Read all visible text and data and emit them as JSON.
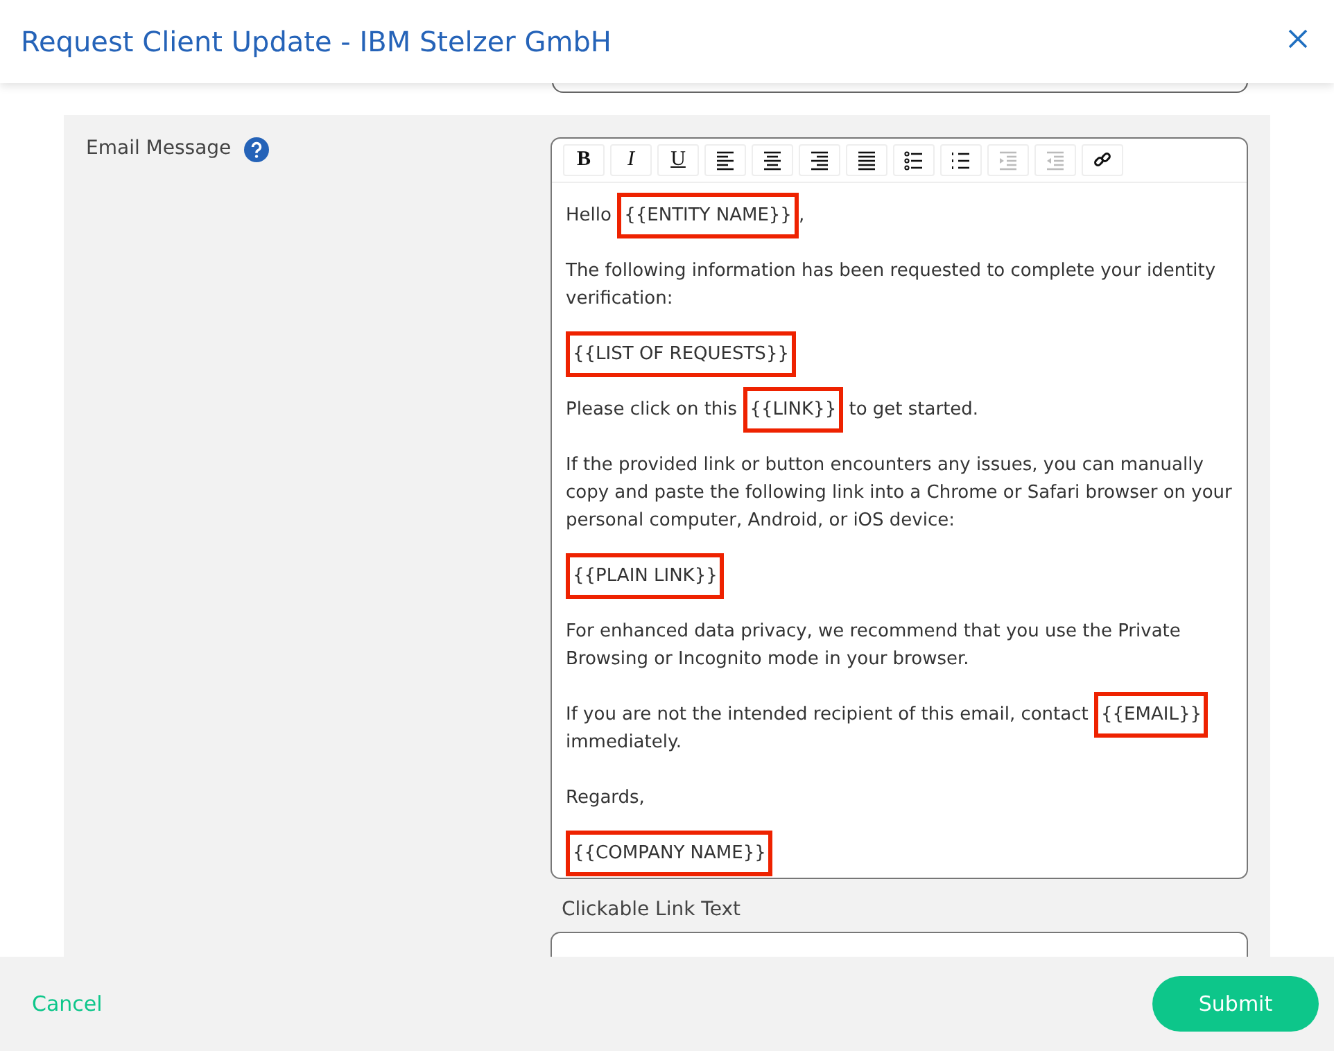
{
  "dialog": {
    "title": "Request Client Update - IBM Stelzer GmbH"
  },
  "email_message": {
    "label": "Email Message",
    "toolbar": [
      {
        "kind": "bold",
        "label": "B",
        "disabled": false
      },
      {
        "kind": "italic",
        "label": "I",
        "disabled": false
      },
      {
        "kind": "underline",
        "label": "U",
        "disabled": false
      },
      {
        "kind": "align-left",
        "disabled": false
      },
      {
        "kind": "align-center",
        "disabled": false
      },
      {
        "kind": "align-right",
        "disabled": false
      },
      {
        "kind": "justify",
        "disabled": false
      },
      {
        "kind": "bullet-list",
        "disabled": false
      },
      {
        "kind": "numbered-list",
        "disabled": false
      },
      {
        "kind": "indent",
        "disabled": true
      },
      {
        "kind": "outdent",
        "disabled": true
      },
      {
        "kind": "link",
        "disabled": false
      }
    ],
    "paragraphs": [
      [
        {
          "kind": "text",
          "text": "Hello "
        },
        {
          "kind": "placeholder",
          "text": "{{ENTITY NAME}}"
        },
        {
          "kind": "text",
          "text": ","
        }
      ],
      [
        {
          "kind": "text",
          "text": "The following information has been requested to complete your identity verification:"
        }
      ],
      [
        {
          "kind": "placeholder",
          "text": "{{LIST OF REQUESTS}}"
        }
      ],
      [
        {
          "kind": "text",
          "text": "Please click on this "
        },
        {
          "kind": "placeholder",
          "text": "{{LINK}}"
        },
        {
          "kind": "text",
          "text": " to get started."
        }
      ],
      [
        {
          "kind": "text",
          "text": "If the provided link or button encounters any issues, you can manually copy and paste the following link into a Chrome or Safari browser on your personal computer, Android, or iOS device:"
        }
      ],
      [
        {
          "kind": "placeholder",
          "text": "{{PLAIN LINK}}"
        }
      ],
      [
        {
          "kind": "text",
          "text": "For enhanced data privacy, we recommend that you use the Private Browsing or Incognito mode in your browser."
        }
      ],
      [
        {
          "kind": "text",
          "text": "If you are not the intended recipient of this email, contact "
        },
        {
          "kind": "placeholder",
          "text": "{{EMAIL}}"
        },
        {
          "kind": "text",
          "text": " immediately."
        }
      ],
      [
        {
          "kind": "text",
          "text": "Regards,"
        }
      ],
      [
        {
          "kind": "placeholder",
          "text": "{{COMPANY NAME}}"
        }
      ]
    ]
  },
  "clickable_link_text": {
    "label": "Clickable Link Text"
  },
  "footer": {
    "cancel": "Cancel",
    "submit": "Submit"
  }
}
